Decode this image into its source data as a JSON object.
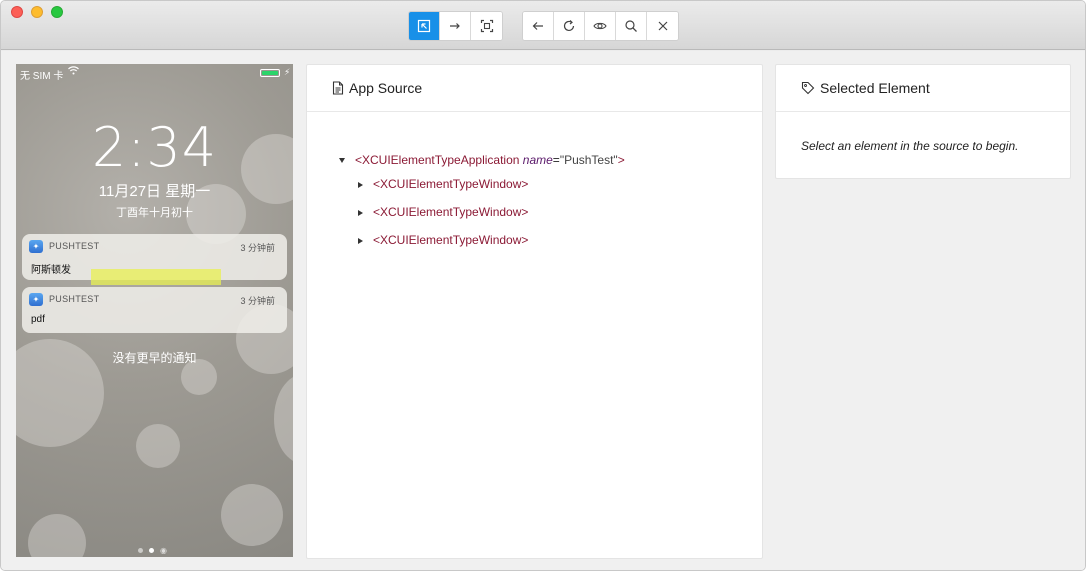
{
  "window": {
    "controls": [
      "close",
      "minimize",
      "maximize"
    ]
  },
  "toolbar": {
    "group1": [
      {
        "icon": "select-element-icon",
        "active": true
      },
      {
        "icon": "swipe-arrow-icon",
        "active": false
      },
      {
        "icon": "tap-coordinates-icon",
        "active": false
      }
    ],
    "group2": [
      {
        "icon": "back-arrow-icon"
      },
      {
        "icon": "refresh-icon"
      },
      {
        "icon": "eye-icon"
      },
      {
        "icon": "search-icon"
      },
      {
        "icon": "close-icon"
      }
    ],
    "accent_color": "#1890e8"
  },
  "device": {
    "status": {
      "carrier": "无 SIM 卡",
      "battery_color": "#2bd46a"
    },
    "time": "2:34",
    "date": "11月27日 星期一",
    "lunar": "丁酉年十月初十",
    "notifications": [
      {
        "app": "PUSHTEST",
        "time": "3 分钟前",
        "message": "阿斯顿发"
      },
      {
        "app": "PUSHTEST",
        "time": "3 分钟前",
        "message": "pdf"
      }
    ],
    "no_more": "没有更早的通知"
  },
  "app_source": {
    "title": "App Source",
    "tree": {
      "root": {
        "tag": "<XCUIElementTypeApplication",
        "attr_name": "name",
        "attr_value": "\"PushTest\"",
        "close": ">"
      },
      "children": [
        {
          "tag": "<XCUIElementTypeWindow>"
        },
        {
          "tag": "<XCUIElementTypeWindow>"
        },
        {
          "tag": "<XCUIElementTypeWindow>"
        }
      ]
    }
  },
  "selected_element": {
    "title": "Selected Element",
    "hint": "Select an element in the source to begin."
  }
}
